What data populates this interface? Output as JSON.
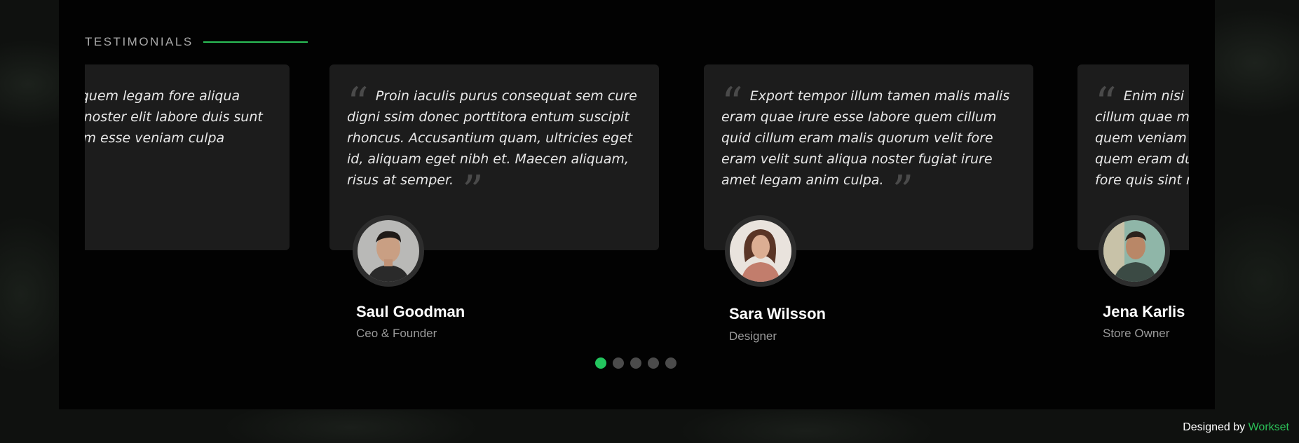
{
  "section": {
    "title": "TESTIMONIALS"
  },
  "testimonials": [
    {
      "text": "Aliqua sint quem legam fore aliqua veniam tempor noster elit labore duis sunt culpa nulla legam esse veniam culpa id.",
      "name": "",
      "role": ""
    },
    {
      "text": "Proin iaculis purus consequat sem cure digni ssim donec porttitora entum suscipit rhoncus. Accusantium quam, ultricies eget id, aliquam eget nibh et. Maecen aliquam, risus at semper.",
      "name": "Saul Goodman",
      "role": "Ceo & Founder",
      "avatar": "avatar-man-icon"
    },
    {
      "text": "Export tempor illum tamen malis malis eram quae irure esse labore quem cillum quid cillum eram malis quorum velit fore eram velit sunt aliqua noster fugiat irure amet legam anim culpa.",
      "name": "Sara Wilsson",
      "role": "Designer",
      "avatar": "avatar-woman-icon"
    },
    {
      "text": "Enim nisi quem export duis labore cillum quae magna enim sint quorum nulla quem veniam duis minim tempor labore quem eram duis noster aute amet eram fore quis sint minim.",
      "name": "Jena Karlis",
      "role": "Store Owner",
      "avatar": "avatar-man-smiling-icon"
    }
  ],
  "pagination": {
    "count": 5,
    "active_index": 0
  },
  "footer": {
    "credit_prefix": "Designed by",
    "credit_link": "Workset"
  },
  "colors": {
    "accent": "#23c55e",
    "card": "#1c1c1c",
    "panel": "#020202"
  }
}
